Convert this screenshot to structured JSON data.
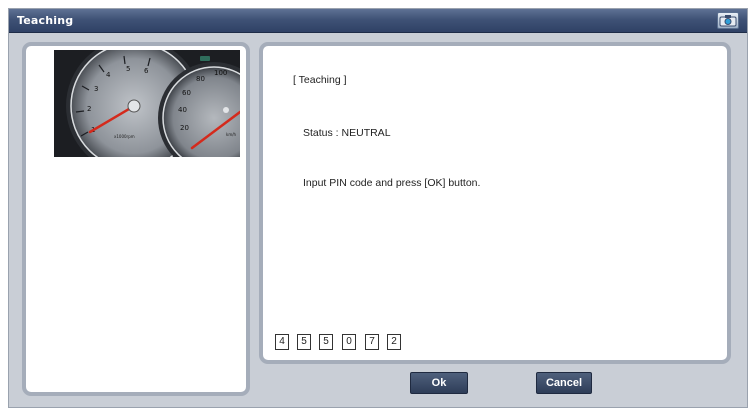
{
  "window": {
    "title": "Teaching",
    "camera_icon": "camera-icon"
  },
  "image": {
    "icon": "instrument-cluster-gauge",
    "tachometer_ticks": [
      "1",
      "2",
      "3",
      "4",
      "5",
      "6"
    ],
    "tachometer_unit": "x1000rpm",
    "speedometer_ticks": [
      "20",
      "40",
      "60",
      "80",
      "100"
    ],
    "speedometer_unit": "km/h"
  },
  "content": {
    "heading": "[ Teaching ]",
    "status": "Status : NEUTRAL",
    "instruction": "Input PIN code and press [OK] button."
  },
  "pin": {
    "digits": [
      "4",
      "5",
      "5",
      "0",
      "7",
      "2"
    ]
  },
  "buttons": {
    "ok_label": "Ok",
    "cancel_label": "Cancel"
  },
  "colors": {
    "titlebar": "#3f5276",
    "panel_border": "#a5adba",
    "button": "#3a4a66",
    "needle": "#d42a1c"
  }
}
